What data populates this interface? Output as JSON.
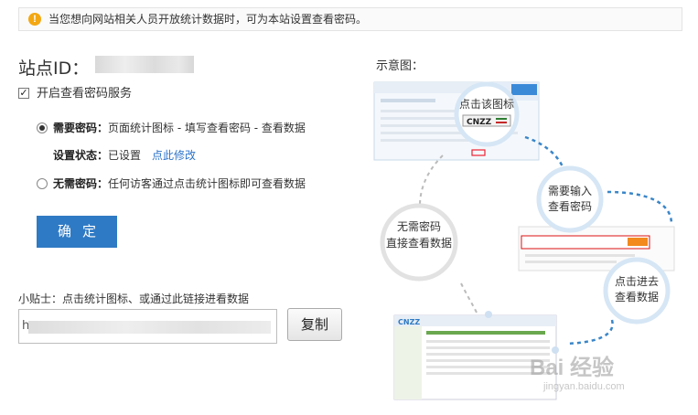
{
  "notice": {
    "icon": "warning-icon",
    "text": "当您想向网站相关人员开放统计数据时，可为本站设置查看密码。"
  },
  "site": {
    "label": "站点ID："
  },
  "enable": {
    "checked": true,
    "label": "开启查看密码服务"
  },
  "options": {
    "need_password": {
      "selected": true,
      "title": "需要密码：",
      "desc": "页面统计图标 - 填写查看密码 - 查看数据"
    },
    "status": {
      "label": "设置状态：",
      "value": "已设置",
      "modify_link": "点此修改"
    },
    "no_password": {
      "selected": false,
      "title": "无需密码：",
      "desc": "任何访客通过点击统计图标即可查看数据"
    }
  },
  "confirm_label": "确定",
  "tip": "小贴士：点击统计图标、或通过此链接进看数据",
  "link_input": {
    "value_prefix": "h"
  },
  "copy_label": "复制",
  "diagram": {
    "title": "示意图：",
    "bubble_click_icon": "点击该图标",
    "badge": "CNZZ",
    "bubble_need_input": [
      "需要输入",
      "查看密码"
    ],
    "bubble_no_password": [
      "无需密码",
      "直接查看数据"
    ],
    "bubble_enter": [
      "点击进去",
      "查看数据"
    ],
    "watermark": "Bai 经验",
    "watermark_url": "jingyan.baidu.com"
  },
  "colors": {
    "accent": "#2f7ac4",
    "link": "#2b73c9",
    "warning": "#f3a712"
  }
}
